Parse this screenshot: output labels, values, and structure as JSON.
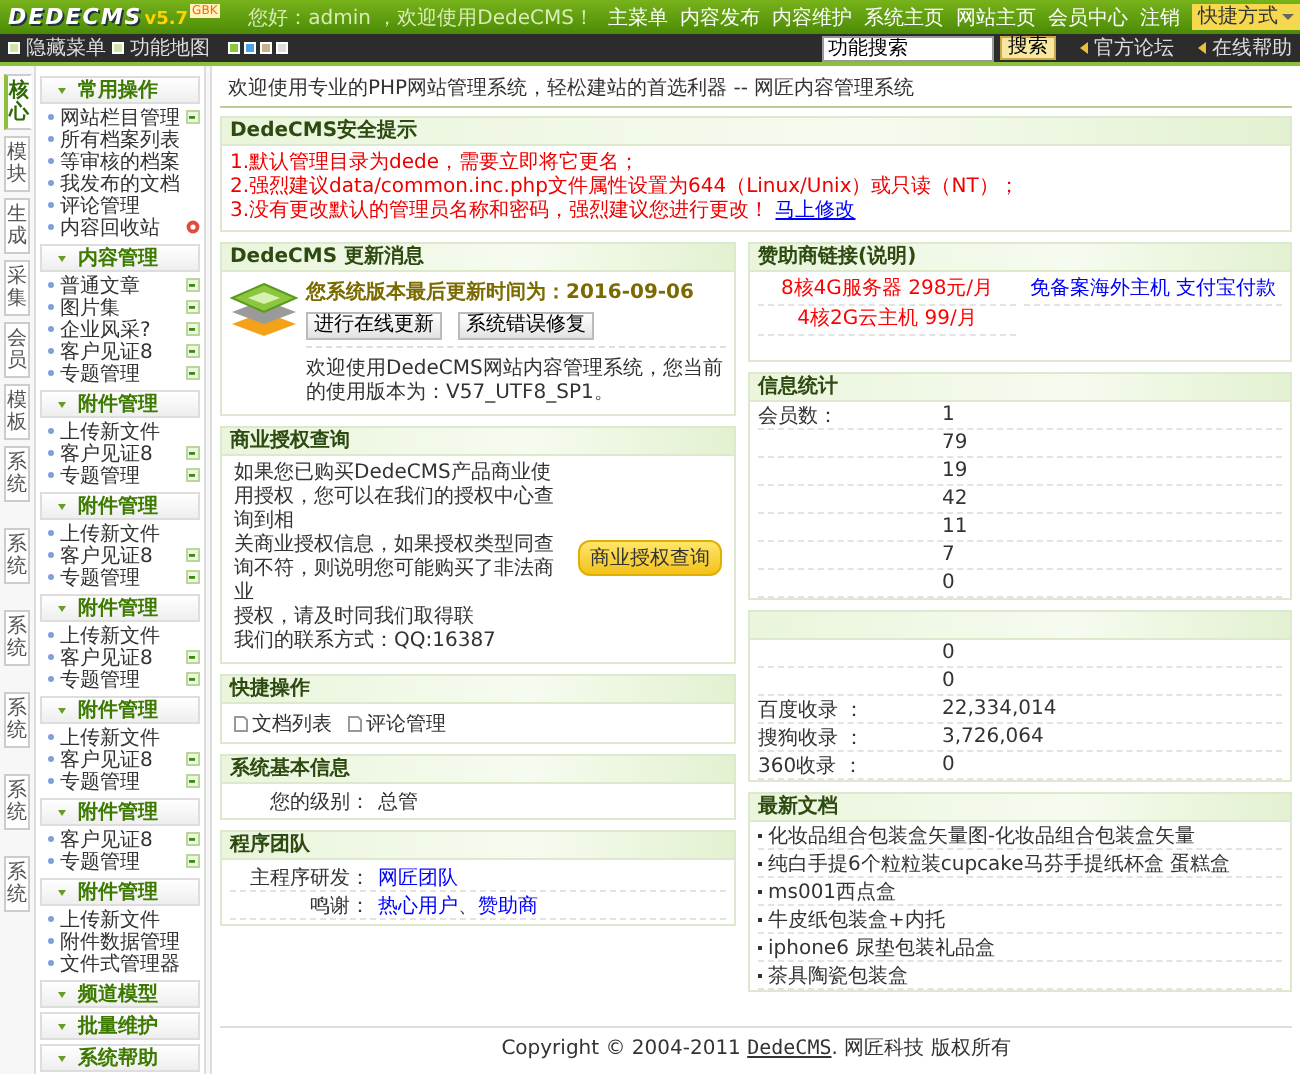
{
  "header": {
    "logo": "DEDECMS",
    "version": "v5.7",
    "edition": "GBK",
    "greeting": "您好：admin ，欢迎使用DedeCMS！",
    "nav": [
      "主菜单",
      "内容发布",
      "内容维护",
      "系统主页",
      "网站主页",
      "会员中心",
      "注销"
    ],
    "shortcut": "快捷方式"
  },
  "toolbar": {
    "hide_menu": "隐藏菜单",
    "function_map": "功能地图",
    "skins": [
      {
        "color": "#8cc63f"
      },
      {
        "color": "#4aa3df"
      },
      {
        "color": "#c8b48a"
      },
      {
        "color": "#dcdcdc"
      }
    ],
    "search": {
      "value": "功能搜索",
      "button": "搜索"
    },
    "links": [
      "官方论坛",
      "在线帮助"
    ]
  },
  "sidebar": {
    "tabs": [
      {
        "label": "核心",
        "selected": true
      },
      {
        "label": "模块",
        "selected": false
      },
      {
        "label": "生成",
        "selected": false
      },
      {
        "label": "采集",
        "selected": false
      },
      {
        "label": "会员",
        "selected": false
      },
      {
        "label": "模板",
        "selected": false
      },
      {
        "label": "系统",
        "selected": false
      },
      {
        "label": "系统",
        "selected": false
      },
      {
        "label": "系统",
        "selected": false
      },
      {
        "label": "系统",
        "selected": false
      },
      {
        "label": "系统",
        "selected": false
      },
      {
        "label": "系统",
        "selected": false
      }
    ],
    "groups": [
      {
        "title": "常用操作",
        "items": [
          {
            "label": "网站栏目管理",
            "kind": "add"
          },
          {
            "label": "所有档案列表",
            "kind": "plain"
          },
          {
            "label": "等审核的档案",
            "kind": "plain"
          },
          {
            "label": "我发布的文档",
            "kind": "plain"
          },
          {
            "label": "评论管理",
            "kind": "plain"
          },
          {
            "label": "内容回收站",
            "kind": "trash"
          }
        ]
      },
      {
        "title": "内容管理",
        "items": [
          {
            "label": "普通文章",
            "kind": "add"
          },
          {
            "label": "图片集",
            "kind": "add"
          },
          {
            "label": "企业风采?",
            "kind": "add"
          },
          {
            "label": "客户见证8",
            "kind": "add"
          },
          {
            "label": "专题管理",
            "kind": "add"
          }
        ]
      },
      {
        "title": "附件管理",
        "items": [
          {
            "label": "上传新文件",
            "kind": "plain"
          },
          {
            "label": "客户见证8",
            "kind": "add"
          },
          {
            "label": "专题管理",
            "kind": "add"
          }
        ]
      },
      {
        "title": "附件管理",
        "items": [
          {
            "label": "上传新文件",
            "kind": "plain"
          },
          {
            "label": "客户见证8",
            "kind": "add"
          },
          {
            "label": "专题管理",
            "kind": "add"
          }
        ]
      },
      {
        "title": "附件管理",
        "items": [
          {
            "label": "上传新文件",
            "kind": "plain"
          },
          {
            "label": "客户见证8",
            "kind": "add"
          },
          {
            "label": "专题管理",
            "kind": "add"
          }
        ]
      },
      {
        "title": "附件管理",
        "items": [
          {
            "label": "上传新文件",
            "kind": "plain"
          },
          {
            "label": "客户见证8",
            "kind": "add"
          },
          {
            "label": "专题管理",
            "kind": "add"
          }
        ]
      },
      {
        "title": "附件管理",
        "items": [
          {
            "label": "客户见证8",
            "kind": "add"
          },
          {
            "label": "专题管理",
            "kind": "add"
          }
        ]
      },
      {
        "title": "附件管理",
        "items": [
          {
            "label": "上传新文件",
            "kind": "plain"
          },
          {
            "label": "附件数据管理",
            "kind": "plain"
          },
          {
            "label": "文件式管理器",
            "kind": "plain"
          }
        ]
      },
      {
        "title": "频道模型"
      },
      {
        "title": "批量维护"
      },
      {
        "title": "系统帮助"
      }
    ]
  },
  "main": {
    "breadcrumb": "欢迎使用专业的PHP网站管理系统，轻松建站的首选利器 -- 网匠内容管理系统",
    "security": {
      "title": "DedeCMS安全提示",
      "lines": [
        "1.默认管理目录为dede，需要立即将它更名；",
        "2.强烈建议data/common.inc.php文件属性设置为644（Linux/Unix）或只读（NT）；",
        "3.没有更改默认的管理员名称和密码，强烈建议您进行更改！"
      ],
      "link": "马上修改"
    },
    "update": {
      "title": "DedeCMS 更新消息",
      "last_update": "您系统版本最后更新时间为：2016-09-06",
      "buttons": [
        "进行在线更新",
        "系统错误修复"
      ],
      "version_text": "欢迎使用DedeCMS网站内容管理系统，您当前的使用版本为：V57_UTF8_SP1。"
    },
    "license": {
      "title": "商业授权查询",
      "lines": [
        "如果您已购买DedeCMS产品商业使用授权，您可以在我们的授权中心查询到相",
        "关商业授权信息，如果授权类型同查询不符，则说明您可能购买了非法商业",
        "授权，请及时同我们取得联",
        "我们的联系方式：QQ:16387"
      ],
      "button": "商业授权查询"
    },
    "quick": {
      "title": "快捷操作",
      "items": [
        "文档列表",
        "评论管理"
      ]
    },
    "sysinfo": {
      "title": "系统基本信息",
      "rows": [
        {
          "label": "您的级别：",
          "value": "总管"
        }
      ]
    },
    "team": {
      "title": "程序团队",
      "rows": [
        {
          "label": "主程序研发：",
          "links": [
            "网匠团队"
          ]
        },
        {
          "label": "鸣谢：",
          "links": [
            "热心用户",
            "赞助商"
          ],
          "separator": "、"
        }
      ]
    },
    "sponsor": {
      "title": "赞助商链接(说明)",
      "links": [
        {
          "text": "8核4G服务器 298元/月",
          "color": "#ff0000"
        },
        {
          "text": "免备案海外主机 支付宝付款",
          "color": "#0000ff"
        },
        {
          "text": "4核2G云主机 99/月",
          "color": "#ff0000"
        }
      ]
    },
    "stats": {
      "title": "信息统计",
      "rows": [
        {
          "label": "会员数：",
          "value": "1"
        },
        {
          "value": "79"
        },
        {
          "value": "19"
        },
        {
          "value": "42"
        },
        {
          "value": "11"
        },
        {
          "value": "7"
        },
        {
          "value": "0"
        }
      ]
    },
    "indexing": {
      "rows": [
        {
          "value": "0"
        },
        {
          "value": "0"
        },
        {
          "label": "百度收录 ：",
          "value": "22,334,014"
        },
        {
          "label": "搜狗收录 ：",
          "value": "3,726,064"
        },
        {
          "label": "360收录 ：",
          "value": "0"
        }
      ]
    },
    "latest": {
      "title": "最新文档",
      "items": [
        "化妆品组合包装盒矢量图-化妆品组合包装盒矢量",
        "纯白手提6个粒粒装cupcake马芬手提纸杯盒 蛋糕盒",
        "ms001西点盒",
        "牛皮纸包装盒+内托",
        "iphone6 尿垫包装礼品盒",
        "茶具陶瓷包装盒"
      ]
    }
  },
  "footer": {
    "copyright": "Copyright © 2004-2011 ",
    "brand": "DedeCMS",
    "rest": ". 网匠科技 版权所有"
  }
}
